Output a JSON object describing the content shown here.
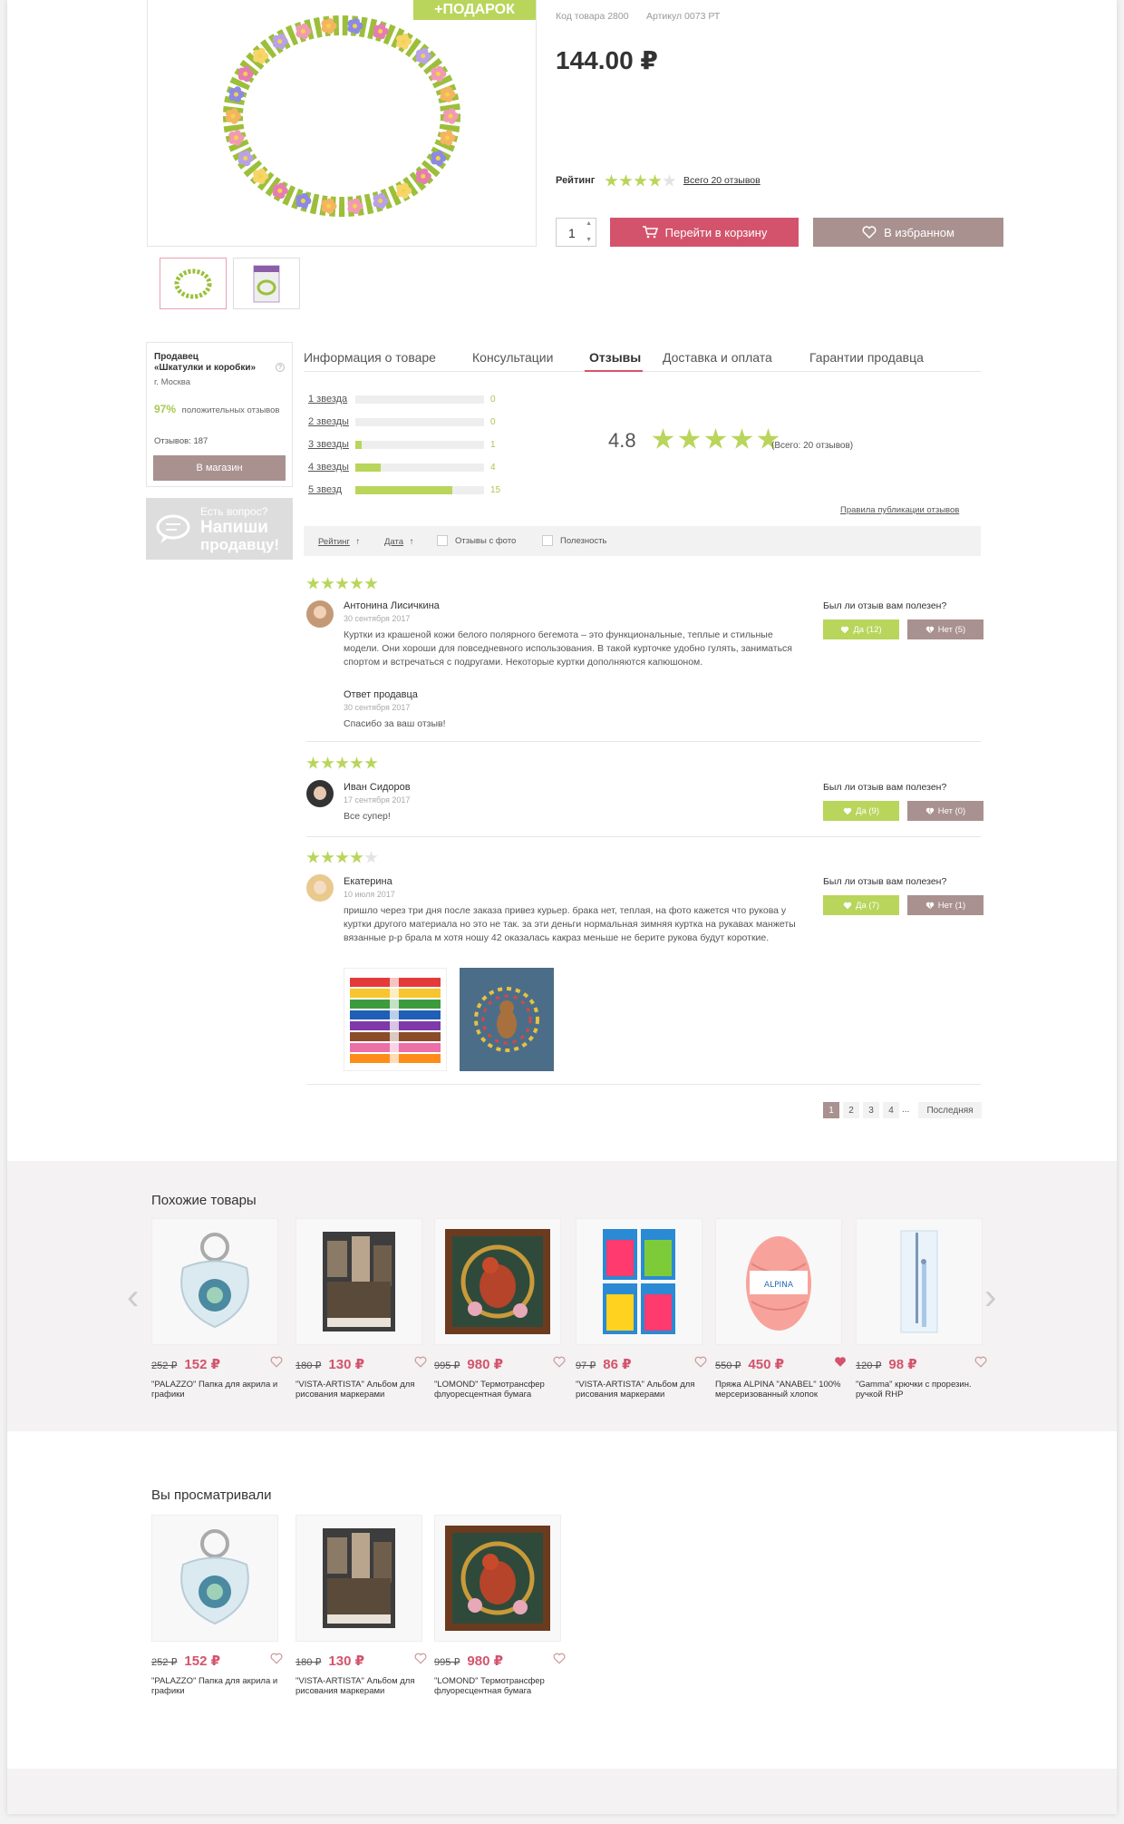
{
  "product": {
    "gift_badge": "+ПОДАРОК",
    "code_label": "Код товара 2800",
    "article_label": "Артикул 0073 РТ",
    "price": "144.00",
    "currency": "₽",
    "rating_label": "Рейтинг",
    "rating_stars": 4,
    "reviews_link": "Всего 20 отзывов",
    "quantity": "1",
    "cart_button": "Перейти в корзину",
    "favorite_button": "В избранном"
  },
  "seller": {
    "title": "Продавец",
    "name": "«Шкатулки и коробки»",
    "city": "г. Москва",
    "positive_percent": "97%",
    "positive_label": "положительных отзывов",
    "reviews_count": "Отзывов: 187",
    "shop_button": "В магазин",
    "ask_top": "Есть вопрос?",
    "ask_line1": "Напиши",
    "ask_line2": "продавцу!"
  },
  "tabs": [
    {
      "label": "Информация о товаре"
    },
    {
      "label": "Консультации"
    },
    {
      "label": "Отзывы"
    },
    {
      "label": "Доставка и оплата"
    },
    {
      "label": "Гарантии продавца"
    }
  ],
  "rating_summary": {
    "rows": [
      {
        "label": "1 звезда",
        "count": "0",
        "fraction": 0
      },
      {
        "label": "2 звезды",
        "count": "0",
        "fraction": 0
      },
      {
        "label": "3 звезды",
        "count": "1",
        "fraction": 0.05
      },
      {
        "label": "4 звезды",
        "count": "4",
        "fraction": 0.2
      },
      {
        "label": "5 звезд",
        "count": "15",
        "fraction": 0.75
      }
    ],
    "average": "4.8",
    "total": "(Всего: 20 отзывов)",
    "rules_link": "Правила публикации отзывов"
  },
  "filters": {
    "rating": "Рейтинг",
    "date": "Дата",
    "with_photo": "Отзывы с фото",
    "usefulness": "Полезность"
  },
  "reviews": [
    {
      "stars": 5,
      "name": "Антонина Лисичкина",
      "date": "30 сентября 2017",
      "text": "Куртки из крашеной кожи белого полярного бегемота – это функциональные, теплые и стильные модели. Они хороши для повседневного использования. В такой курточке удобно гулять, заниматься спортом и встречаться с подругами. Некоторые куртки дополняются капюшоном.",
      "helpful_q": "Был ли отзыв вам полезен?",
      "yes": "Да (12)",
      "no": "Нет (5)",
      "reply_title": "Ответ продавца",
      "reply_date": "30 сентября 2017",
      "reply_text": "Спасибо за ваш отзыв!"
    },
    {
      "stars": 5,
      "name": "Иван Сидоров",
      "date": "17 сентября 2017",
      "text": "Все супер!",
      "helpful_q": "Был ли отзыв вам полезен?",
      "yes": "Да (9)",
      "no": "Нет (0)"
    },
    {
      "stars": 4,
      "name": "Екатерина",
      "date": "10 июля 2017",
      "text": "пришло через три дня после заказа привез курьер. брака нет, теплая, на фото кажется что рукова у куртки другого материала но это не так. за эти деньги нормальная зимняя куртка на рукавах манжеты вязанные р-р брала м хотя ношу 42 оказалась какраз меньше не берите рукова будут короткие.",
      "helpful_q": "Был ли отзыв вам полезен?",
      "yes": "Да (7)",
      "no": "Нет (1)"
    }
  ],
  "pagination": {
    "pages": [
      "1",
      "2",
      "3",
      "4"
    ],
    "ellipsis": "...",
    "last": "Последняя"
  },
  "similar": {
    "title": "Похожие товары",
    "items": [
      {
        "old": "252 ₽",
        "new": "152 ₽",
        "title": "\"PALAZZO\" Папка для акрила и графики",
        "fav": false,
        "icon": "keychain"
      },
      {
        "old": "180 ₽",
        "new": "130 ₽",
        "title": "\"VISTA-ARTISTA\" Альбом для рисования маркерами",
        "fav": false,
        "icon": "album"
      },
      {
        "old": "995 ₽",
        "new": "980 ₽",
        "title": "\"LOMOND\" Термотрансфер флуоресцентная бумага",
        "fav": false,
        "icon": "rooster"
      },
      {
        "old": "97 ₽",
        "new": "86 ₽",
        "title": "\"VISTA-ARTISTA\" Альбом для рисования маркерами",
        "fav": false,
        "icon": "cards"
      },
      {
        "old": "550 ₽",
        "new": "450 ₽",
        "title": "Пряжа ALPINA \"ANABEL\" 100% мерсеризованный хлопок",
        "fav": true,
        "icon": "yarn"
      },
      {
        "old": "120 ₽",
        "new": "98 ₽",
        "title": "\"Gamma\" крючки с прорезин. ручкой RHP",
        "fav": false,
        "icon": "hook"
      }
    ]
  },
  "viewed": {
    "title": "Вы просматривали",
    "items": [
      {
        "old": "252 ₽",
        "new": "152 ₽",
        "title": "\"PALAZZO\" Папка для акрила и графики"
      },
      {
        "old": "180 ₽",
        "new": "130 ₽",
        "title": "\"VISTA-ARTISTA\" Альбом для рисования маркерами"
      },
      {
        "old": "995 ₽",
        "new": "980 ₽",
        "title": "\"LOMOND\" Термотрансфер флуоресцентная бумага"
      }
    ]
  },
  "colors": {
    "accent_pink": "#d4536c",
    "accent_green": "#b9d55b",
    "muted_brown": "#a8918f"
  }
}
